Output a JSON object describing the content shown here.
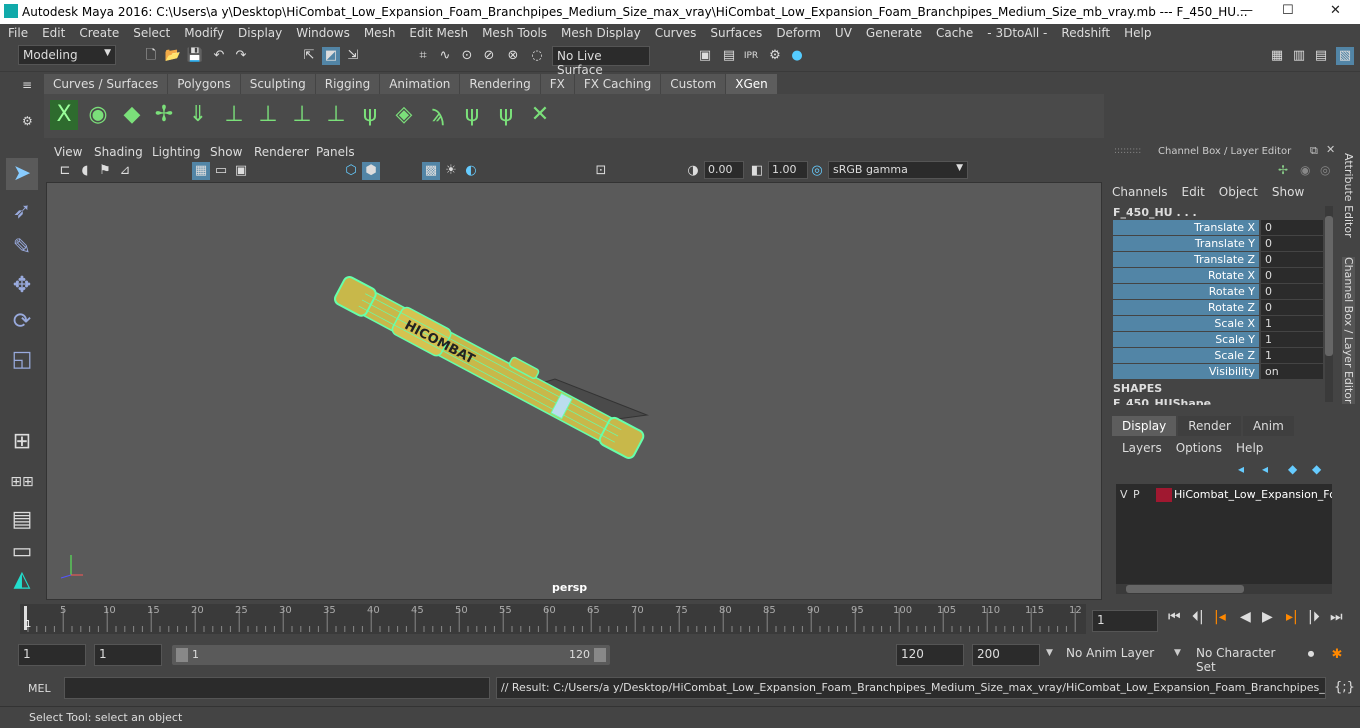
{
  "window": {
    "title": "Autodesk Maya 2016: C:\\Users\\a y\\Desktop\\HiCombat_Low_Expansion_Foam_Branchpipes_Medium_Size_max_vray\\HiCombat_Low_Expansion_Foam_Branchpipes_Medium_Size_mb_vray.mb  ---  F_450_HU...",
    "minimize": "—",
    "maximize": "☐",
    "close": "✕"
  },
  "menubar": [
    "File",
    "Edit",
    "Create",
    "Select",
    "Modify",
    "Display",
    "Windows",
    "Mesh",
    "Edit Mesh",
    "Mesh Tools",
    "Mesh Display",
    "Curves",
    "Surfaces",
    "Deform",
    "UV",
    "Generate",
    "Cache",
    "- 3DtoAll -",
    "Redshift",
    "Help"
  ],
  "statusline": {
    "mode": "Modeling",
    "live_surface": "No Live Surface"
  },
  "shelf": {
    "tabs": [
      "Curves / Surfaces",
      "Polygons",
      "Sculpting",
      "Rigging",
      "Animation",
      "Rendering",
      "FX",
      "FX Caching",
      "Custom",
      "XGen"
    ],
    "active": "XGen"
  },
  "viewport": {
    "menu": [
      "View",
      "Shading",
      "Lighting",
      "Show",
      "Renderer",
      "Panels"
    ],
    "exposure": "0.00",
    "gamma": "1.00",
    "colorspace": "sRGB gamma",
    "camera_label": "persp",
    "model_label": "HICOMBAT"
  },
  "channelbox": {
    "title": "Channel Box / Layer Editor",
    "menu": [
      "Channels",
      "Edit",
      "Object",
      "Show"
    ],
    "object": "F_450_HU . . .",
    "channels": [
      {
        "label": "Translate X",
        "value": "0"
      },
      {
        "label": "Translate Y",
        "value": "0"
      },
      {
        "label": "Translate Z",
        "value": "0"
      },
      {
        "label": "Rotate X",
        "value": "0"
      },
      {
        "label": "Rotate Y",
        "value": "0"
      },
      {
        "label": "Rotate Z",
        "value": "0"
      },
      {
        "label": "Scale X",
        "value": "1"
      },
      {
        "label": "Scale Y",
        "value": "1"
      },
      {
        "label": "Scale Z",
        "value": "1"
      },
      {
        "label": "Visibility",
        "value": "on"
      }
    ],
    "shapes_label": "SHAPES",
    "shape_name": "F_450_HUShape"
  },
  "layer_editor": {
    "tabs": [
      "Display",
      "Render",
      "Anim"
    ],
    "active": "Display",
    "menu": [
      "Layers",
      "Options",
      "Help"
    ],
    "layer": {
      "v": "V",
      "p": "P",
      "name": "HiCombat_Low_Expansion_Foam_Branchpipes_Medium_Size",
      "color": "#a01830"
    }
  },
  "side_tabs": [
    "Attribute Editor",
    "Channel Box / Layer Editor"
  ],
  "timeline": {
    "ticks": [
      "5",
      "10",
      "15",
      "20",
      "25",
      "30",
      "35",
      "40",
      "45",
      "50",
      "55",
      "60",
      "65",
      "70",
      "75",
      "80",
      "85",
      "90",
      "95",
      "100",
      "105",
      "110",
      "115",
      "12"
    ],
    "current_start": "1",
    "current_frame": "1"
  },
  "range": {
    "start": "1",
    "playback_start": "1",
    "slider_start": "1",
    "slider_end": "120",
    "playback_end": "120",
    "end": "200",
    "anim_layer": "No Anim Layer",
    "character_set": "No Character Set"
  },
  "mel": {
    "label": "MEL",
    "result": "// Result: C:/Users/a y/Desktop/HiCombat_Low_Expansion_Foam_Branchpipes_Medium_Size_max_vray/HiCombat_Low_Expansion_Foam_Branchpipes_Medium_Siz"
  },
  "help_line": "Select Tool: select an object",
  "colors": {
    "accent": "#5285a6",
    "wire": "#66ffaa",
    "model": "#c8b84a"
  }
}
